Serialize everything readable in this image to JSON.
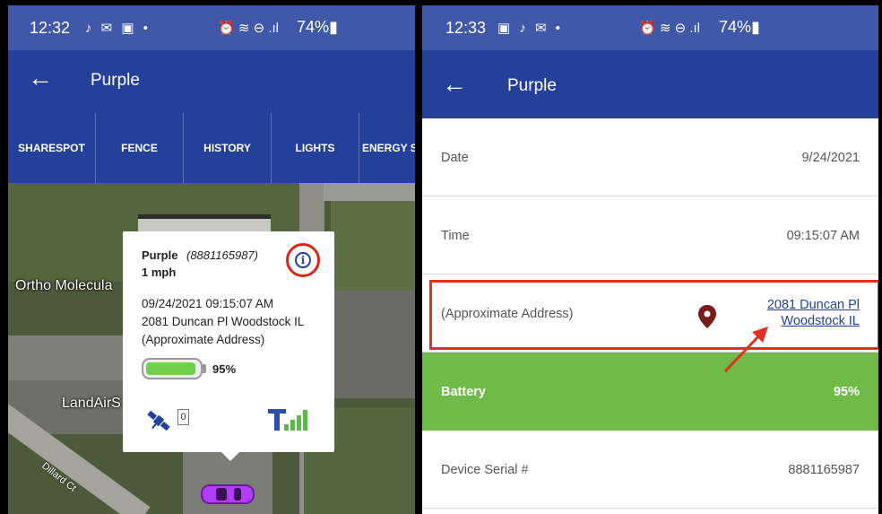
{
  "left_screen": {
    "status": {
      "time": "12:32",
      "notif_icons": "♪ ✉ ▣ •",
      "sys_icons": "⏰ ≋ ⊖ .ıl",
      "battery": "74%▮"
    },
    "appbar": {
      "back_icon": "←",
      "title": "Purple"
    },
    "tabs": [
      "SHARESPOT",
      "FENCE",
      "HISTORY",
      "LIGHTS",
      "ENERGY S"
    ],
    "map": {
      "label_business_1": "Ortho Molecula",
      "label_business_2": "LandAirS",
      "label_street": "Dillard Ct",
      "car_icon": "car-icon"
    },
    "popup": {
      "name": "Purple",
      "id": "(8881165987)",
      "speed": "1 mph",
      "datetime": "09/24/2021 09:15:07 AM",
      "address": "2081 Duncan Pl Woodstock IL",
      "address_note": "(Approximate Address)",
      "info_icon": "i",
      "battery_percent": "95%",
      "battery_level": 0.95,
      "satellite_count": "0"
    }
  },
  "right_screen": {
    "status": {
      "time": "12:33",
      "notif_icons": "▣ ♪ ✉ •",
      "sys_icons": "⏰ ≋ ⊖ .ıl",
      "battery": "74%▮"
    },
    "appbar": {
      "back_icon": "←",
      "title": "Purple"
    },
    "rows": {
      "date_label": "Date",
      "date_value": "9/24/2021",
      "time_label": "Time",
      "time_value": "09:15:07 AM",
      "address_label": "(Approximate Address)",
      "address_line1": "2081 Duncan Pl",
      "address_line2": "Woodstock IL",
      "battery_label": "Battery",
      "battery_value": "95%",
      "serial_label": "Device Serial #",
      "serial_value": "8881165987"
    }
  },
  "colors": {
    "header_blue": "#24409a",
    "status_blue": "#3f59a8",
    "battery_green": "#6fba48",
    "highlight_red": "#e0311f",
    "pin_maroon": "#7a1c1c"
  }
}
